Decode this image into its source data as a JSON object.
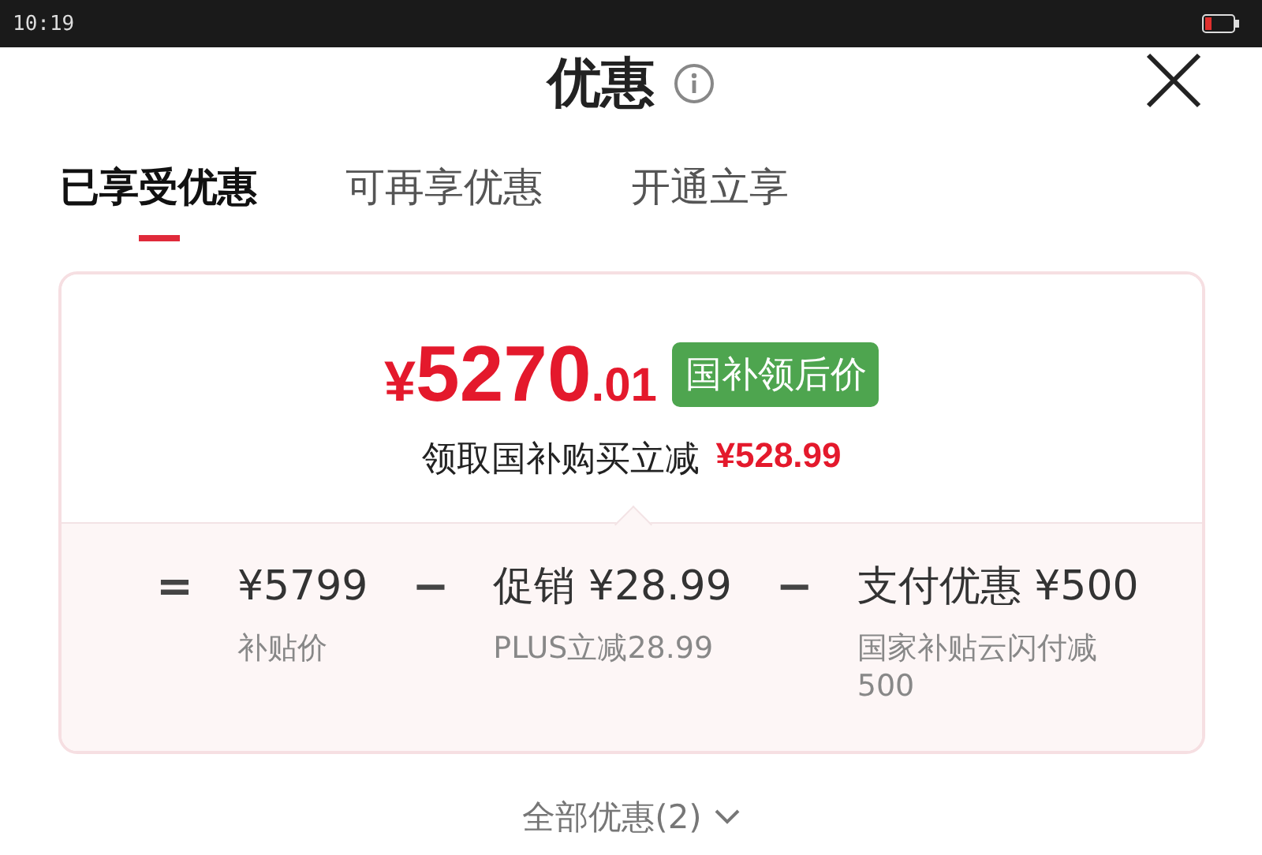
{
  "status_bar": {
    "time": "10:19"
  },
  "header": {
    "title": "优惠"
  },
  "tabs": [
    {
      "label": "已享受优惠",
      "selected": true
    },
    {
      "label": "可再享优惠",
      "selected": false
    },
    {
      "label": "开通立享",
      "selected": false
    }
  ],
  "summary": {
    "symbol": "¥",
    "whole": "5270",
    "fraction": ".01",
    "badge": "国补领后价",
    "note": "领取国补购买立减",
    "note_amount": "¥528.99"
  },
  "breakdown": [
    {
      "kind": "operator",
      "text": "="
    },
    {
      "kind": "item",
      "amount": "¥5799",
      "caption": "补贴价"
    },
    {
      "kind": "operator",
      "text": "−"
    },
    {
      "kind": "item",
      "amount": "促销 ¥28.99",
      "caption": "PLUS立减28.99"
    },
    {
      "kind": "operator",
      "text": "−"
    },
    {
      "kind": "item",
      "amount": "支付优惠 ¥500",
      "caption": "国家补贴云闪付减500"
    }
  ],
  "footer": {
    "label": "全部优惠(2)"
  }
}
